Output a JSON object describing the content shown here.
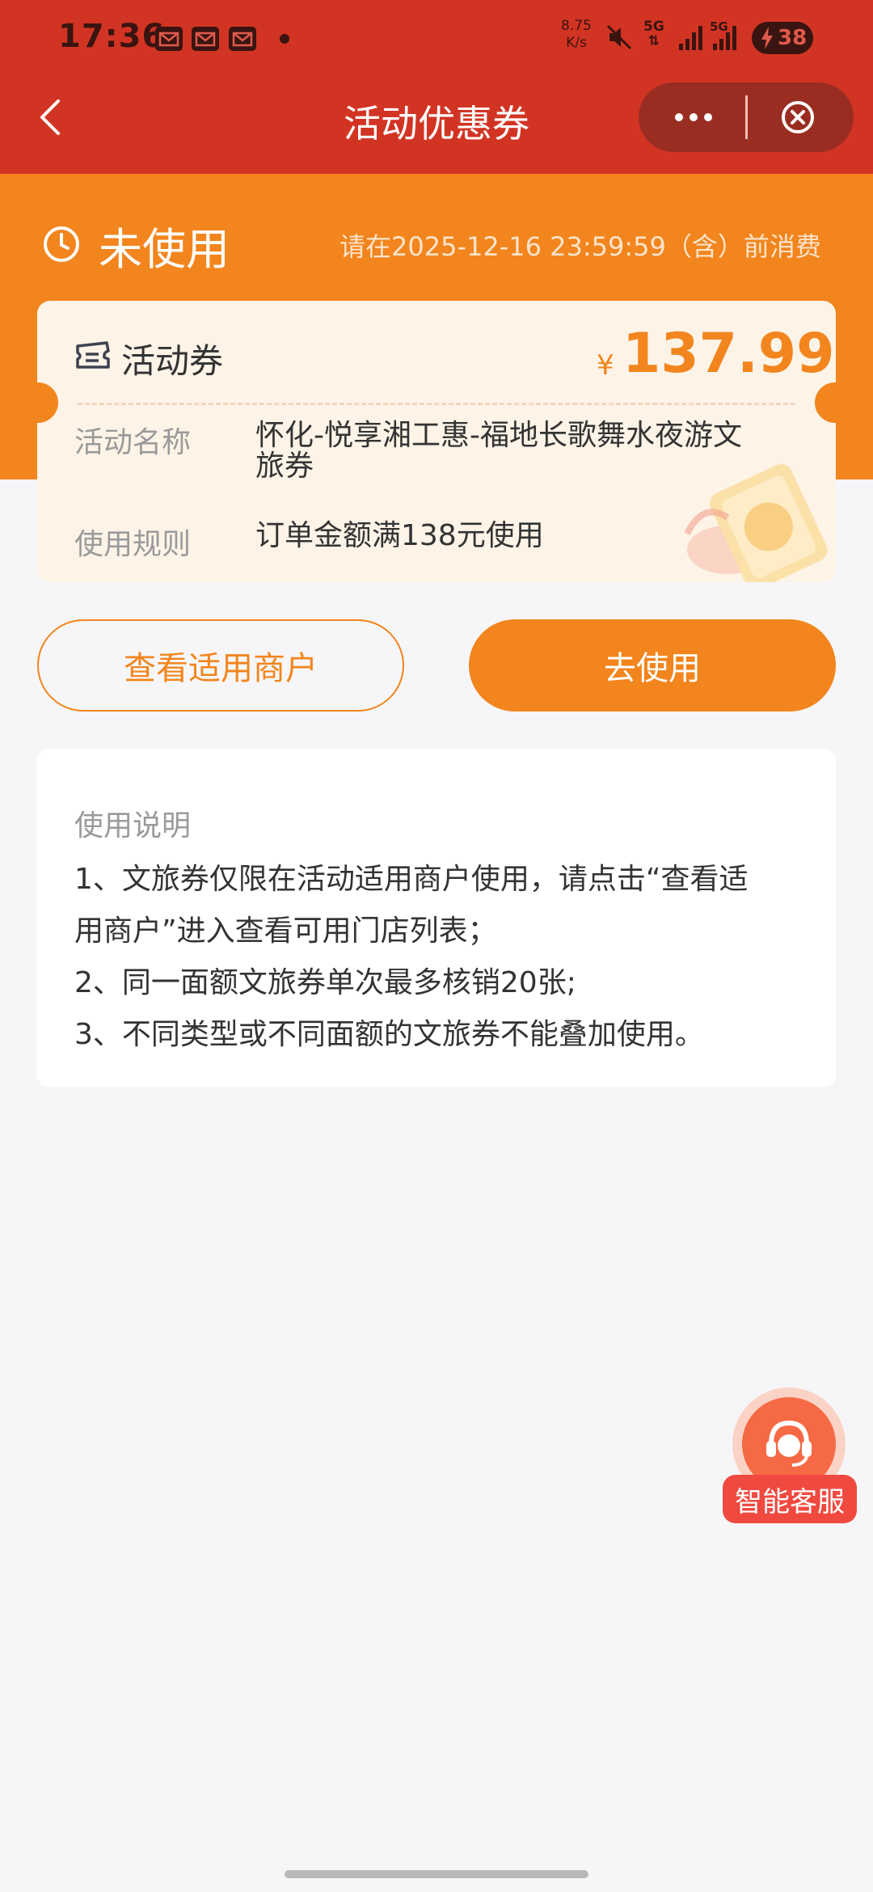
{
  "status_bar": {
    "time": "17:36",
    "net_speed_value": "8.75",
    "net_speed_unit": "K/s",
    "network_1": "5G",
    "network_2": "5G",
    "battery": "38"
  },
  "nav": {
    "title": "活动优惠券"
  },
  "coupon_status": {
    "label": "未使用",
    "expire_note": "请在2025-12-16 23:59:59（含）前消费"
  },
  "coupon": {
    "type": "活动券",
    "currency_symbol": "¥",
    "amount": "137.99",
    "name_label": "活动名称",
    "name_line1": "怀化-悦享湘工惠-福地长歌舞水夜游文",
    "name_line2": "旅券",
    "rule_label": "使用规则",
    "rule_value": "订单金额满138元使用"
  },
  "actions": {
    "view_merchants": "查看适用商户",
    "use_now": "去使用"
  },
  "instructions": {
    "title": "使用说明",
    "line1": "1、文旅券仅限在活动适用商户使用，请点击“查看适",
    "line2": "用商户”进入查看可用门店列表；",
    "line3": "2、同一面额文旅券单次最多核销20张;",
    "line4": "3、不同类型或不同面额的文旅券不能叠加使用。"
  },
  "support": {
    "label": "智能客服"
  },
  "theme": {
    "header_red": "#d23423",
    "accent_orange": "#f2851d",
    "background": "#f6f6f8"
  }
}
